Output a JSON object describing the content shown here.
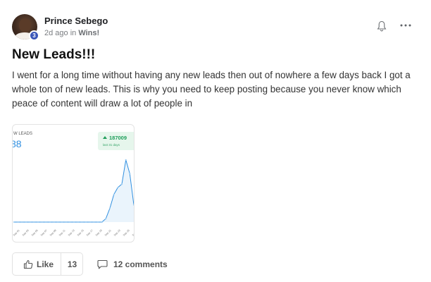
{
  "post": {
    "author": "Prince Sebego",
    "level": "3",
    "time_ago": "2d ago in",
    "category": "Wins!",
    "title": "New Leads!!!",
    "body": "I went for a long time without having any new leads then out of nowhere a few days back I got a whole ton of new leads. This is why you need to keep posting because you never know which peace of content will draw a lot of people in"
  },
  "icons": {
    "bell": "bell-icon",
    "more": "more-options-icon",
    "like": "thumbs-up-icon",
    "comment": "comment-icon"
  },
  "actions": {
    "like_label": "Like",
    "like_count": "13",
    "comments_label": "12 comments"
  },
  "colors": {
    "accent_blue": "#2f8fe0",
    "green_badge": "#1e9e5a",
    "level_badge": "#3a56b8"
  },
  "chart_data": {
    "type": "area",
    "title": "W LEADS",
    "headline_value": "88",
    "badge_value": "187009",
    "badge_caption": "last 31 days",
    "x_tick_labels": [
      "Sep 01",
      "Sep 03",
      "Sep 05",
      "Sep 07",
      "Sep 09",
      "Sep 11",
      "Sep 13",
      "Sep 15",
      "Sep 17",
      "Sep 19",
      "Sep 21",
      "Sep 23",
      "Sep 25",
      "Sep"
    ],
    "values": [
      0,
      0,
      0,
      0,
      0,
      0,
      0,
      0,
      0,
      0,
      0,
      0,
      0,
      0,
      0,
      0,
      0,
      0,
      0,
      0,
      0,
      0,
      0,
      1,
      4,
      8,
      10,
      11,
      18,
      14,
      5
    ],
    "ylim": [
      0,
      20
    ],
    "grid": false
  }
}
